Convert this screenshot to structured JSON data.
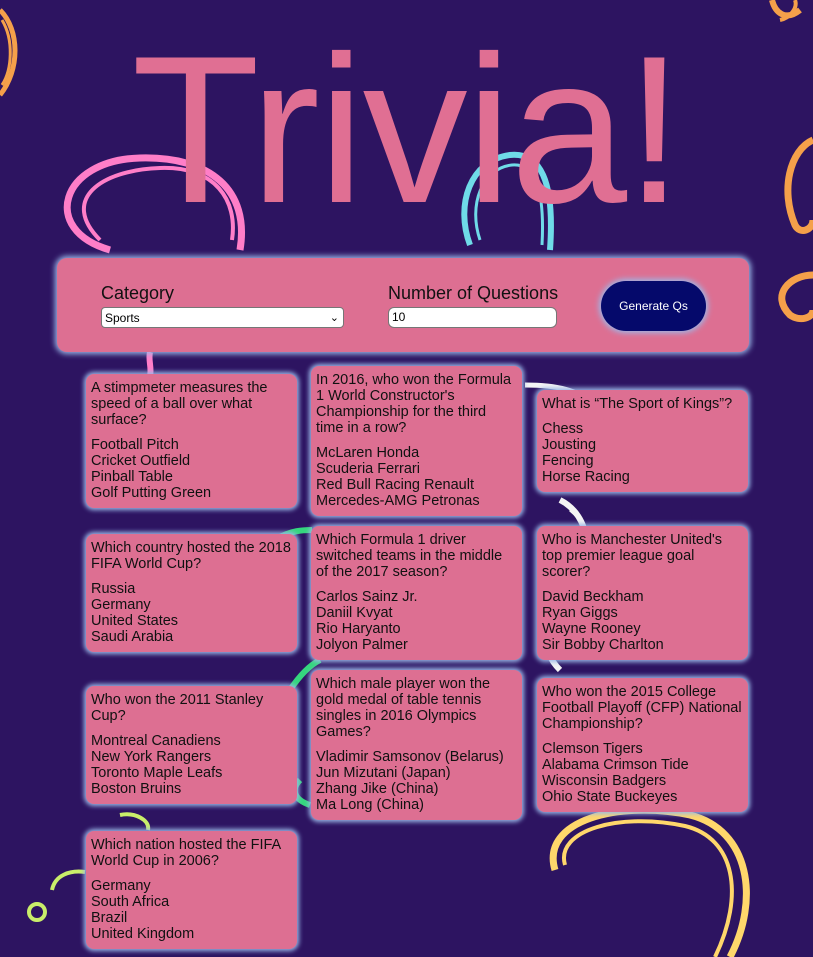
{
  "title": "Trivia!",
  "controls": {
    "category_label": "Category",
    "category_value": "Sports",
    "count_label": "Number of Questions",
    "count_value": "10",
    "generate_label": "Generate Qs"
  },
  "icons": {
    "select_chevron": "chevron-down-icon"
  },
  "colors": {
    "background": "#2d1461",
    "title": "#e06f93",
    "panel": "#dd6f92",
    "button": "#05096b",
    "glow": "#9bb8e8"
  },
  "questions": [
    {
      "question": "A stimpmeter measures the speed of a ball over what surface?",
      "options": [
        "Football Pitch",
        "Cricket Outfield",
        "Pinball Table",
        "Golf Putting Green"
      ]
    },
    {
      "question": "In 2016, who won the Formula 1 World Constructor's Championship for the third time in a row?",
      "options": [
        "McLaren Honda",
        "Scuderia Ferrari",
        "Red Bull Racing Renault",
        "Mercedes-AMG Petronas"
      ]
    },
    {
      "question": "What is “The Sport of Kings”?",
      "options": [
        "Chess",
        "Jousting",
        "Fencing",
        "Horse Racing"
      ]
    },
    {
      "question": "Which country hosted the 2018 FIFA World Cup?",
      "options": [
        "Russia",
        "Germany",
        "United States",
        "Saudi Arabia"
      ]
    },
    {
      "question": "Which Formula 1 driver switched teams in the middle of the 2017 season?",
      "options": [
        "Carlos Sainz Jr.",
        "Daniil Kvyat",
        "Rio Haryanto",
        "Jolyon Palmer"
      ]
    },
    {
      "question": "Who is Manchester United's top premier league goal scorer?",
      "options": [
        "David Beckham",
        "Ryan Giggs",
        "Wayne Rooney",
        "Sir Bobby Charlton"
      ]
    },
    {
      "question": "Who won the 2011 Stanley Cup?",
      "options": [
        "Montreal Canadiens",
        "New York Rangers",
        "Toronto Maple Leafs",
        "Boston Bruins"
      ]
    },
    {
      "question": "Which male player won the gold medal of table tennis singles in 2016 Olympics Games?",
      "options": [
        "Vladimir Samsonov (Belarus)",
        "Jun Mizutani (Japan)",
        "Zhang Jike (China)",
        "Ma Long (China)"
      ]
    },
    {
      "question": "Who won the 2015 College Football Playoff (CFP) National Championship?",
      "options": [
        "Clemson Tigers",
        "Alabama Crimson Tide",
        "Wisconsin Badgers",
        "Ohio State Buckeyes"
      ]
    },
    {
      "question": "Which nation hosted the FIFA World Cup in 2006?",
      "options": [
        "Germany",
        "South Africa",
        "Brazil",
        "United Kingdom"
      ]
    }
  ]
}
